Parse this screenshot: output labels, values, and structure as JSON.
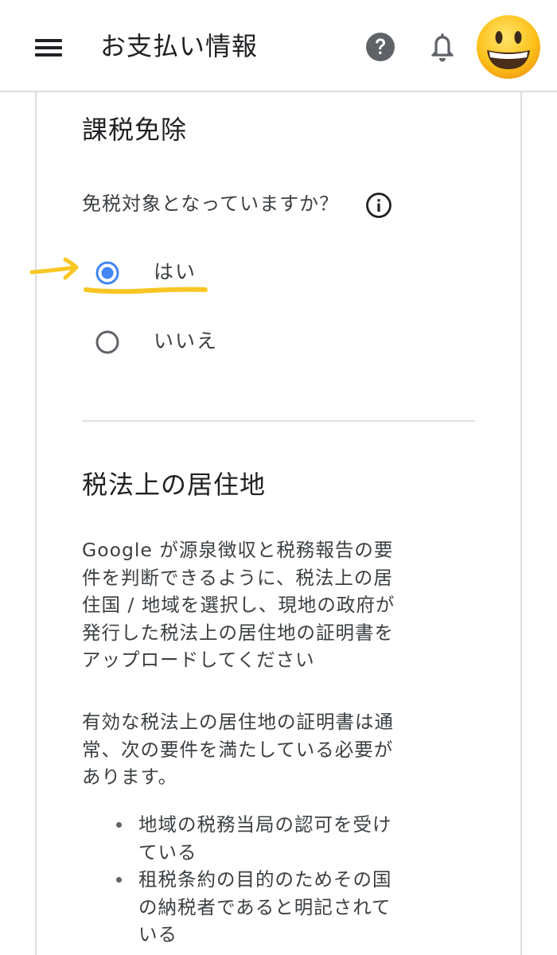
{
  "header": {
    "title": "お支払い情報",
    "menu_icon": "menu-icon",
    "help_icon": "help-icon",
    "notification_icon": "bell-icon",
    "avatar_icon": "grinning-face-emoji"
  },
  "tax_exemption": {
    "title": "課税免除",
    "question": "免税対象となっていますか？",
    "info_icon": "info-icon",
    "options": [
      {
        "label": "はい",
        "selected": true
      },
      {
        "label": "いいえ",
        "selected": false
      }
    ],
    "accent_color": "#4285f4",
    "annotation_color": "#f9c623"
  },
  "tax_residence": {
    "title": "税法上の居住地",
    "paragraph1": "Google が源泉徴収と税務報告の要\n件を判断できるように、税法上の居\n住国 / 地域を選択し、現地の政府が\n発行した税法上の居住地の証明書を\nアップロードしてください",
    "paragraph2": "有効な税法上の居住地の証明書は通\n常、次の要件を満たしている必要が\nあります。",
    "requirements": [
      "地域の税務当局の認可を受け\nている",
      "租税条約の目的のためその国\nの納税者であると明記されて\nいる"
    ]
  }
}
